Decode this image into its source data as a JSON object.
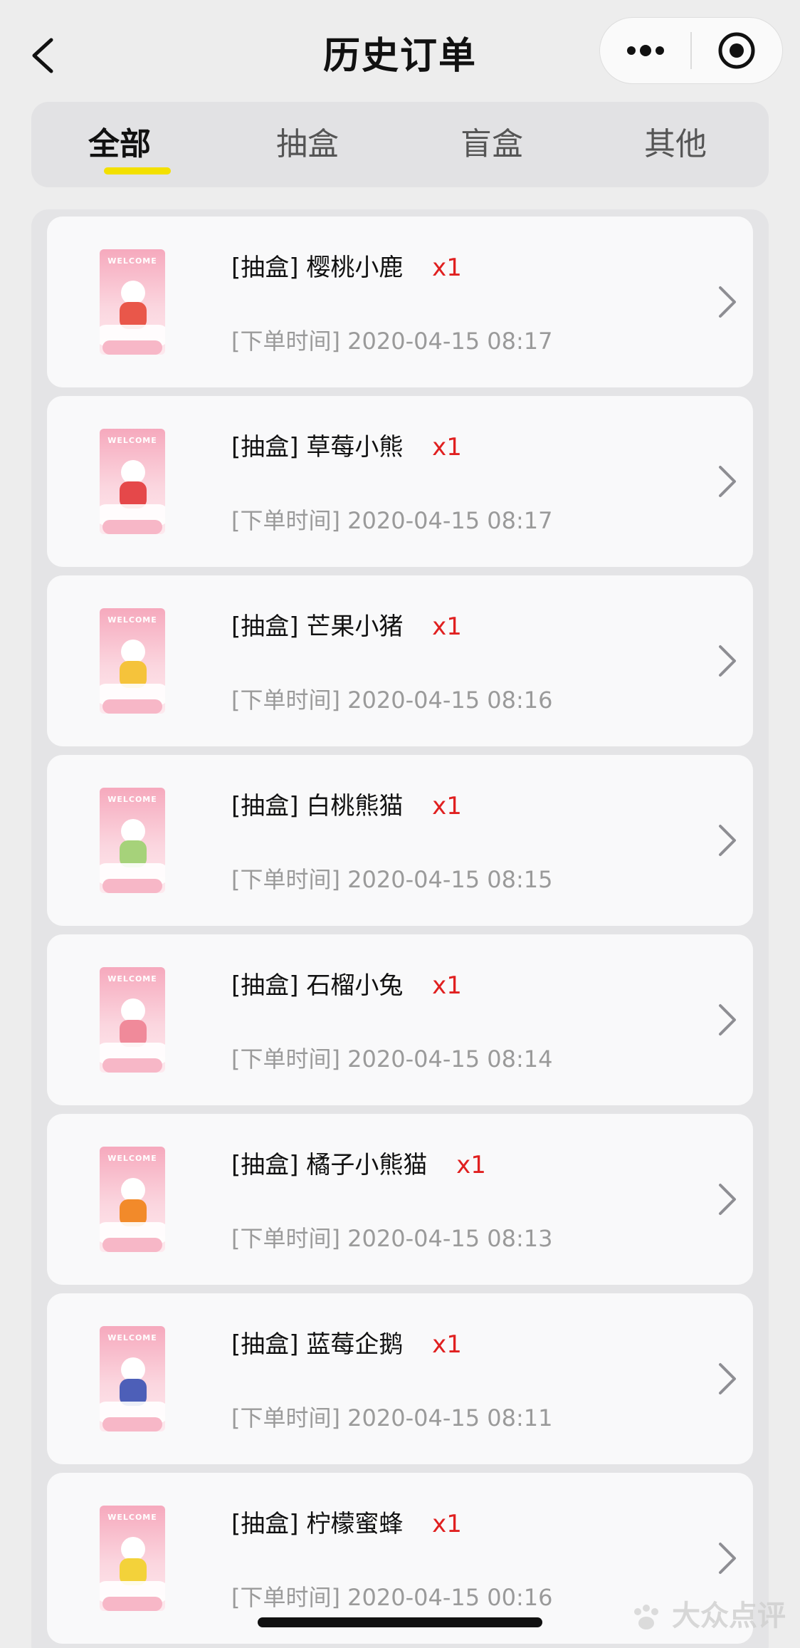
{
  "navbar": {
    "title": "历史订单",
    "back_icon": "chevron-left-icon",
    "more_icon": "more-dots-icon",
    "close_icon": "target-circle-icon"
  },
  "tabs": [
    {
      "label": "全部",
      "active": true
    },
    {
      "label": "抽盒",
      "active": false
    },
    {
      "label": "盲盒",
      "active": false
    },
    {
      "label": "其他",
      "active": false
    }
  ],
  "colors": {
    "accent_underline": "#f3e000",
    "quantity": "#e02020",
    "time_text": "#9a9a9a"
  },
  "orders": [
    {
      "tag": "[抽盒]",
      "name": "樱桃小鹿",
      "qty": "x1",
      "time_label": "[下单时间]",
      "time": "2020-04-15 08:17",
      "thumb_color": "#e9574a"
    },
    {
      "tag": "[抽盒]",
      "name": "草莓小熊",
      "qty": "x1",
      "time_label": "[下单时间]",
      "time": "2020-04-15 08:17",
      "thumb_color": "#e5484a"
    },
    {
      "tag": "[抽盒]",
      "name": "芒果小猪",
      "qty": "x1",
      "time_label": "[下单时间]",
      "time": "2020-04-15 08:16",
      "thumb_color": "#f5c33b"
    },
    {
      "tag": "[抽盒]",
      "name": "白桃熊猫",
      "qty": "x1",
      "time_label": "[下单时间]",
      "time": "2020-04-15 08:15",
      "thumb_color": "#a6d27a"
    },
    {
      "tag": "[抽盒]",
      "name": "石榴小兔",
      "qty": "x1",
      "time_label": "[下单时间]",
      "time": "2020-04-15 08:14",
      "thumb_color": "#f08a9a"
    },
    {
      "tag": "[抽盒]",
      "name": "橘子小熊猫",
      "qty": "x1",
      "time_label": "[下单时间]",
      "time": "2020-04-15 08:13",
      "thumb_color": "#f28a2a"
    },
    {
      "tag": "[抽盒]",
      "name": "蓝莓企鹅",
      "qty": "x1",
      "time_label": "[下单时间]",
      "time": "2020-04-15 08:11",
      "thumb_color": "#4d5fb8"
    },
    {
      "tag": "[抽盒]",
      "name": "柠檬蜜蜂",
      "qty": "x1",
      "time_label": "[下单时间]",
      "time": "2020-04-15 00:16",
      "thumb_color": "#f3d23a"
    }
  ],
  "thumbnail_text": "WELCOME",
  "watermark": "大众点评"
}
